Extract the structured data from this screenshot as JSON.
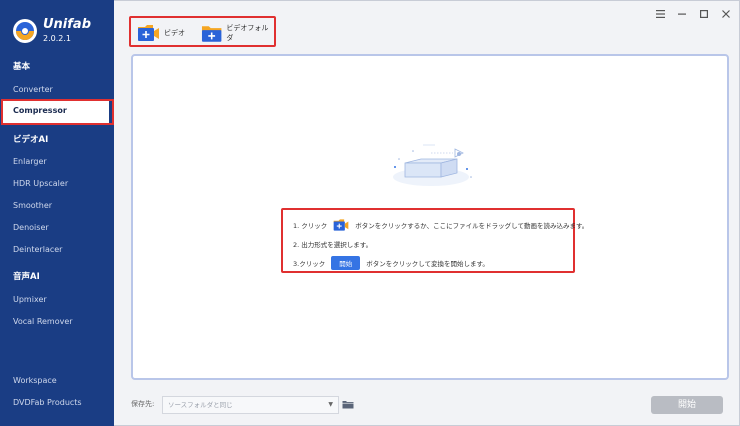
{
  "app": {
    "name": "Unifab",
    "version": "2.0.2.1"
  },
  "sidebar": {
    "sections": [
      {
        "heading": "基本",
        "items": [
          "Converter",
          "Compressor"
        ]
      },
      {
        "heading": "ビデオAI",
        "items": [
          "Enlarger",
          "HDR Upscaler",
          "Smoother",
          "Denoiser",
          "Deinterlacer"
        ]
      },
      {
        "heading": "音声AI",
        "items": [
          "Upmixer",
          "Vocal Remover"
        ]
      }
    ],
    "bottom_items": [
      "Workspace",
      "DVDFab Products"
    ],
    "active_item": "Compressor"
  },
  "toolbar": {
    "add_video_label": "ビデオ",
    "add_folder_label": "ビデオフォルダ"
  },
  "instructions": {
    "step1_prefix": "1. クリック",
    "step1_suffix": "ボタンをクリックするか、ここにファイルをドラッグして動画を読み込みます。",
    "step2": "2. 出力形式を選択します。",
    "step3_prefix": "3.クリック",
    "step3_button": "開始",
    "step3_suffix": "ボタンをクリックして変換を開始します。"
  },
  "footer": {
    "save_label": "保存先:",
    "save_value": "ソースフォルダと同じ",
    "start_label": "開始"
  },
  "colors": {
    "sidebar_bg": "#1a3d84",
    "highlight": "#e03030",
    "accent": "#3574e4",
    "folder": "#f5a623"
  }
}
